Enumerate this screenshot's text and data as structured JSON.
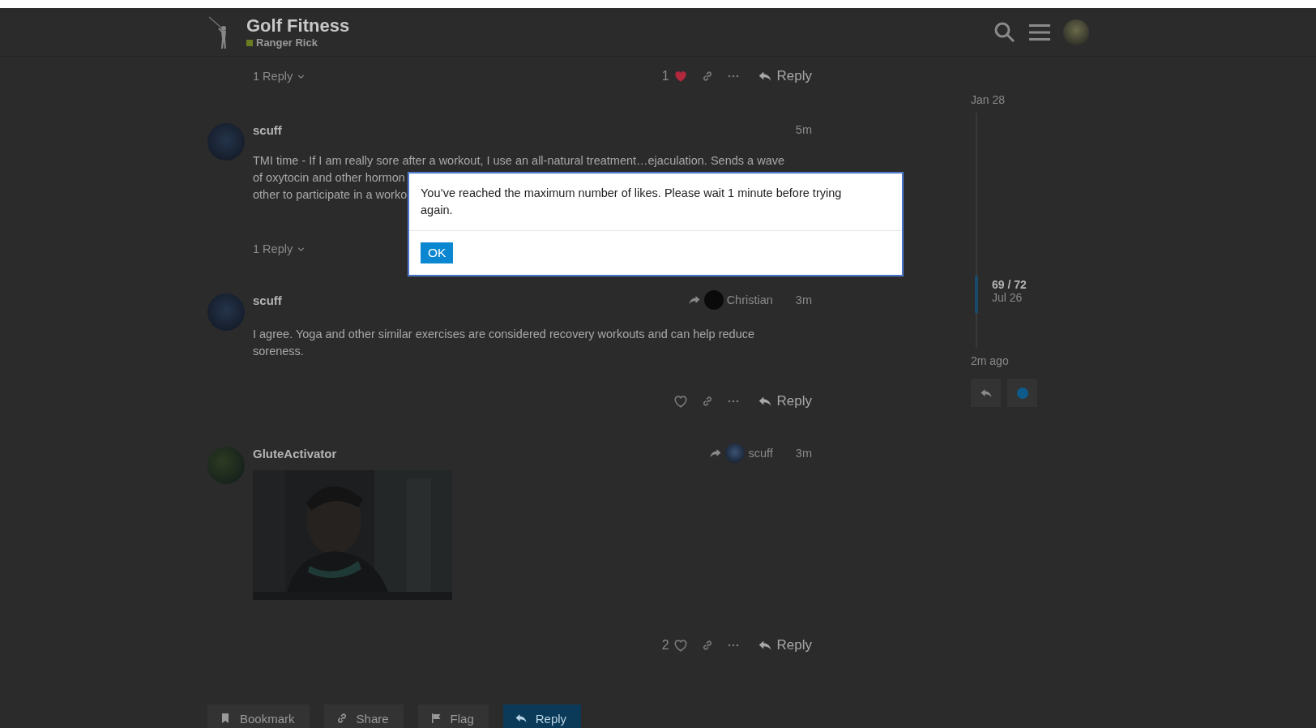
{
  "header": {
    "title": "Golf Fitness",
    "category": "Ranger Rick"
  },
  "posts": [
    {
      "kind": "tail",
      "replies_toggle": "1 Reply",
      "actions": {
        "like_count": "1",
        "liked": true,
        "reply": "Reply"
      }
    },
    {
      "kind": "post",
      "username": "scuff",
      "time": "5m",
      "body_lines": [
        "TMI time - If I am really sore after a workout, I use an all-natural treatment…ejaculation. Sends a wave",
        "of oxytocin and other hormon",
        "other to participate in a worko"
      ],
      "replies_toggle": "1 Reply"
    },
    {
      "kind": "post",
      "username": "scuff",
      "time": "3m",
      "reply_to": "Christian",
      "body": "I agree. Yoga and other similar exercises are considered recovery workouts and can help reduce soreness.",
      "actions": {
        "liked": false,
        "reply": "Reply"
      }
    },
    {
      "kind": "post",
      "username": "GluteActivator",
      "time": "3m",
      "reply_to": "scuff",
      "actions": {
        "like_count": "2",
        "liked": false,
        "reply": "Reply"
      }
    }
  ],
  "footer_buttons": [
    {
      "label": "Bookmark",
      "kind": "bookmark",
      "primary": false
    },
    {
      "label": "Share",
      "kind": "share",
      "primary": false
    },
    {
      "label": "Flag",
      "kind": "flag",
      "primary": false
    },
    {
      "label": "Reply",
      "kind": "reply",
      "primary": true
    }
  ],
  "timeline": {
    "start": "Jan 28",
    "position": "69 / 72",
    "current_date": "Jul 26",
    "last_activity": "2m ago",
    "level": 0.85
  },
  "dialog": {
    "message": "You’ve reached the maximum number of likes. Please wait 1 minute before trying again.",
    "button": "OK"
  }
}
